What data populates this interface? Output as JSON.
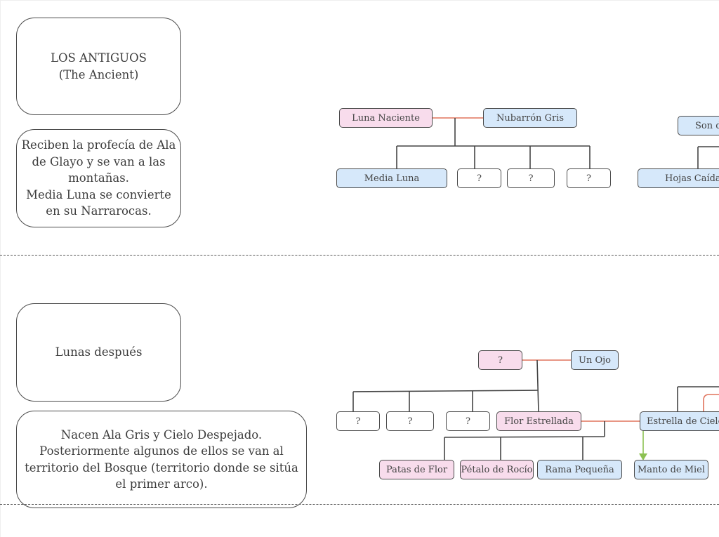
{
  "colors": {
    "female_node": "#f8dcec",
    "male_node": "#d6e8fa",
    "unknown_node": "#ffffff",
    "partner_line": "#e0735c",
    "descent_line": "#444444",
    "arrow_line": "#8cc152"
  },
  "sections": [
    {
      "title": "LOS ANTIGUOS\n(The Ancient)",
      "title_lines": [
        "LOS ANTIGUOS",
        "(The Ancient)"
      ],
      "description_lines": [
        "Reciben la profecía de Ala",
        "de Glayo y se van a las",
        "montañas.",
        "Media Luna se convierte",
        "en su Narrarocas."
      ]
    },
    {
      "title": "Lunas después",
      "description_lines": [
        "Nacen Ala Gris y Cielo Despejado.",
        "Posteriormente algunos de ellos se van al",
        "territorio del Bosque (territorio donde se sitúa",
        "el primer arco)."
      ]
    }
  ],
  "tree1": {
    "parents": [
      {
        "name": "Luna Naciente",
        "type": "female"
      },
      {
        "name": "Nubarrón Gris",
        "type": "male"
      }
    ],
    "children": [
      {
        "name": "Media Luna",
        "type": "male"
      },
      {
        "name": "?",
        "type": "unknown"
      },
      {
        "name": "?",
        "type": "unknown"
      },
      {
        "name": "?",
        "type": "unknown"
      }
    ]
  },
  "tree2": {
    "parent": {
      "name": "Son d",
      "type": "male"
    },
    "children": [
      {
        "name": "Hojas Caídas",
        "type": "male"
      }
    ]
  },
  "tree3": {
    "parents": [
      {
        "name": "?",
        "type": "female"
      },
      {
        "name": "Un Ojo",
        "type": "male"
      }
    ],
    "children": [
      {
        "name": "?",
        "type": "unknown"
      },
      {
        "name": "?",
        "type": "unknown"
      },
      {
        "name": "?",
        "type": "unknown"
      },
      {
        "name": "Flor Estrellada",
        "type": "female"
      }
    ],
    "partner_of_child": {
      "name": "Estrella de Cielo",
      "type": "male"
    },
    "grandchildren": [
      {
        "name": "Patas de Flor",
        "type": "female"
      },
      {
        "name": "Pétalo de Rocío",
        "type": "female"
      },
      {
        "name": "Rama Pequeña",
        "type": "male"
      }
    ],
    "arrow_target": {
      "name": "Manto de Miel",
      "type": "male"
    }
  }
}
